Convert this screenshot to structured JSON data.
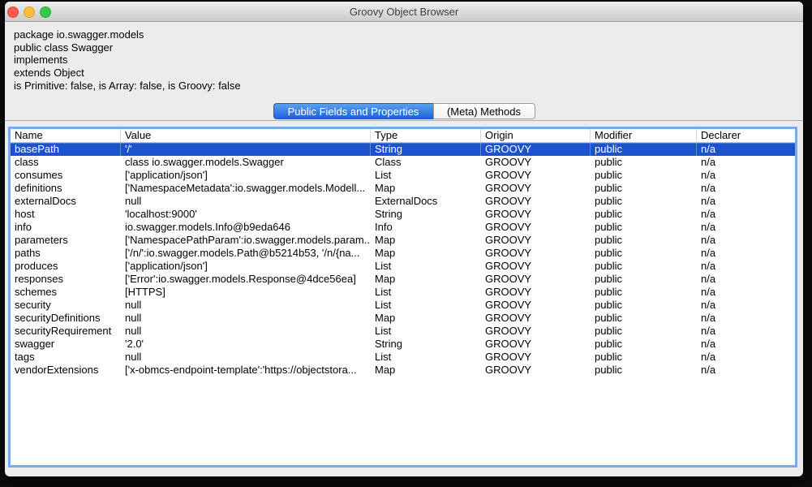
{
  "window": {
    "title": "Groovy Object Browser"
  },
  "traffic_lights": [
    "close",
    "minimize",
    "zoom"
  ],
  "class_info": {
    "lines": [
      "package io.swagger.models",
      "public class Swagger",
      "implements",
      "extends Object",
      "is Primitive: false, is Array: false, is Groovy: false"
    ]
  },
  "tabs": [
    {
      "label": "Public Fields and Properties",
      "selected": true
    },
    {
      "label": "(Meta) Methods",
      "selected": false
    }
  ],
  "table": {
    "columns": [
      "Name",
      "Value",
      "Type",
      "Origin",
      "Modifier",
      "Declarer"
    ],
    "rows": [
      {
        "name": "basePath",
        "value": "'/'",
        "type": "String",
        "origin": "GROOVY",
        "modifier": "public",
        "declarer": "n/a",
        "selected": true
      },
      {
        "name": "class",
        "value": "class io.swagger.models.Swagger",
        "type": "Class",
        "origin": "GROOVY",
        "modifier": "public",
        "declarer": "n/a",
        "selected": false
      },
      {
        "name": "consumes",
        "value": "['application/json']",
        "type": "List",
        "origin": "GROOVY",
        "modifier": "public",
        "declarer": "n/a",
        "selected": false
      },
      {
        "name": "definitions",
        "value": "['NamespaceMetadata':io.swagger.models.Modell...",
        "type": "Map",
        "origin": "GROOVY",
        "modifier": "public",
        "declarer": "n/a",
        "selected": false
      },
      {
        "name": "externalDocs",
        "value": "null",
        "type": "ExternalDocs",
        "origin": "GROOVY",
        "modifier": "public",
        "declarer": "n/a",
        "selected": false
      },
      {
        "name": "host",
        "value": "'localhost:9000'",
        "type": "String",
        "origin": "GROOVY",
        "modifier": "public",
        "declarer": "n/a",
        "selected": false
      },
      {
        "name": "info",
        "value": "io.swagger.models.Info@b9eda646",
        "type": "Info",
        "origin": "GROOVY",
        "modifier": "public",
        "declarer": "n/a",
        "selected": false
      },
      {
        "name": "parameters",
        "value": "['NamespacePathParam':io.swagger.models.param...",
        "type": "Map",
        "origin": "GROOVY",
        "modifier": "public",
        "declarer": "n/a",
        "selected": false
      },
      {
        "name": "paths",
        "value": "['/n/':io.swagger.models.Path@b5214b53, '/n/{na...",
        "type": "Map",
        "origin": "GROOVY",
        "modifier": "public",
        "declarer": "n/a",
        "selected": false
      },
      {
        "name": "produces",
        "value": "['application/json']",
        "type": "List",
        "origin": "GROOVY",
        "modifier": "public",
        "declarer": "n/a",
        "selected": false
      },
      {
        "name": "responses",
        "value": "['Error':io.swagger.models.Response@4dce56ea]",
        "type": "Map",
        "origin": "GROOVY",
        "modifier": "public",
        "declarer": "n/a",
        "selected": false
      },
      {
        "name": "schemes",
        "value": "[HTTPS]",
        "type": "List",
        "origin": "GROOVY",
        "modifier": "public",
        "declarer": "n/a",
        "selected": false
      },
      {
        "name": "security",
        "value": "null",
        "type": "List",
        "origin": "GROOVY",
        "modifier": "public",
        "declarer": "n/a",
        "selected": false
      },
      {
        "name": "securityDefinitions",
        "value": "null",
        "type": "Map",
        "origin": "GROOVY",
        "modifier": "public",
        "declarer": "n/a",
        "selected": false
      },
      {
        "name": "securityRequirement",
        "value": "null",
        "type": "List",
        "origin": "GROOVY",
        "modifier": "public",
        "declarer": "n/a",
        "selected": false
      },
      {
        "name": "swagger",
        "value": "'2.0'",
        "type": "String",
        "origin": "GROOVY",
        "modifier": "public",
        "declarer": "n/a",
        "selected": false
      },
      {
        "name": "tags",
        "value": "null",
        "type": "List",
        "origin": "GROOVY",
        "modifier": "public",
        "declarer": "n/a",
        "selected": false
      },
      {
        "name": "vendorExtensions",
        "value": "['x-obmcs-endpoint-template':'https://objectstora...",
        "type": "Map",
        "origin": "GROOVY",
        "modifier": "public",
        "declarer": "n/a",
        "selected": false
      }
    ]
  },
  "colors": {
    "selection_blue": "#1c52cc",
    "tab_blue_top": "#5a9fee",
    "tab_blue_bottom": "#1c64d9",
    "focus_ring": "#7fa9e5",
    "close_red": "#fc5952",
    "minimize_yellow": "#fdbe40",
    "zoom_green": "#35c84b"
  }
}
